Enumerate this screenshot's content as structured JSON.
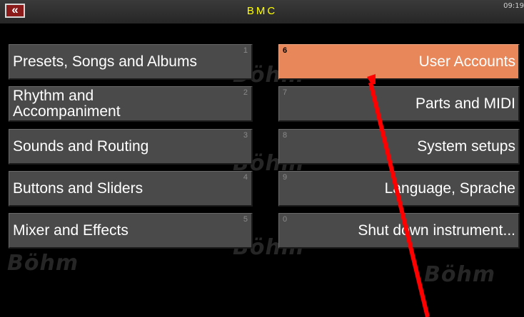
{
  "header": {
    "back_label": "«",
    "title": "BMC",
    "clock": "09:19"
  },
  "watermark": "Böhm",
  "menu": {
    "left": [
      {
        "num": "1",
        "label": "Presets, Songs and Albums"
      },
      {
        "num": "2",
        "label": "Rhythm and Accompaniment"
      },
      {
        "num": "3",
        "label": "Sounds and Routing"
      },
      {
        "num": "4",
        "label": "Buttons and Sliders"
      },
      {
        "num": "5",
        "label": "Mixer and Effects"
      }
    ],
    "right": [
      {
        "num": "6",
        "label": "User Accounts",
        "selected": true
      },
      {
        "num": "7",
        "label": "Parts and MIDI"
      },
      {
        "num": "8",
        "label": "System setups"
      },
      {
        "num": "9",
        "label": "Language, Sprache"
      },
      {
        "num": "0",
        "label": "Shut down instrument..."
      }
    ]
  },
  "colors": {
    "accent": "#e8875a",
    "title": "#ffff00",
    "annotation_arrow": "#ff0000"
  }
}
